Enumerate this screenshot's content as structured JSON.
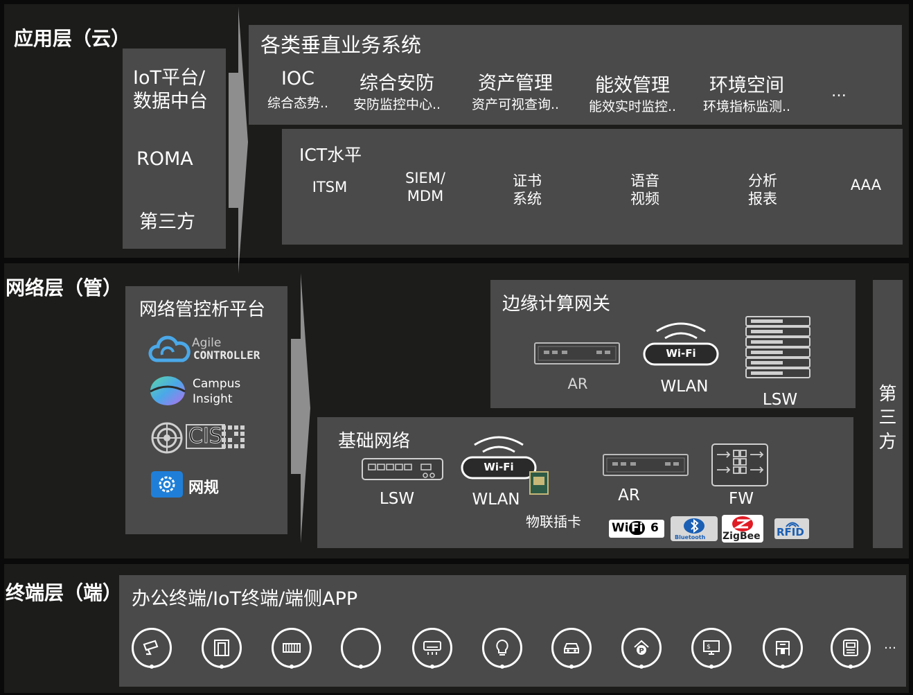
{
  "layers": {
    "app": {
      "title": "应用层（云）",
      "platform": {
        "line1": "IoT平台/",
        "line2": "数据中台",
        "roma": "ROMA",
        "third": "第三方"
      },
      "vertical": {
        "title": "各类垂直业务系统",
        "items": [
          {
            "name": "IOC",
            "sub": "综合态势.."
          },
          {
            "name": "综合安防",
            "sub": "安防监控中心.."
          },
          {
            "name": "资产管理",
            "sub": "资产可视查询.."
          },
          {
            "name": "能效管理",
            "sub": "能效实时监控.."
          },
          {
            "name": "环境空间",
            "sub": "环境指标监测.."
          }
        ],
        "more": "…"
      },
      "ict": {
        "title": "ICT水平",
        "items": [
          {
            "l1": "ITSM",
            "l2": ""
          },
          {
            "l1": "SIEM/",
            "l2": "MDM"
          },
          {
            "l1": "证书",
            "l2": "系统"
          },
          {
            "l1": "语音",
            "l2": "视频"
          },
          {
            "l1": "分析",
            "l2": "报表"
          },
          {
            "l1": "AAA",
            "l2": ""
          }
        ]
      }
    },
    "net": {
      "title": "网络层（管）",
      "mgmt": {
        "title": "网络管控析平台",
        "agile_top": "Agile",
        "agile_bottom": "CONTROLLER",
        "campus_l1": "Campus",
        "campus_l2": "Insight",
        "cis": "CIS",
        "wanggui": "网规"
      },
      "edge": {
        "title": "边缘计算网关",
        "ar": "AR",
        "wlan": "WLAN",
        "lsw": "LSW",
        "wifi_label": "Wi-Fi"
      },
      "base": {
        "title": "基础网络",
        "lsw": "LSW",
        "wlan": "WLAN",
        "iot_card": "物联插卡",
        "ar": "AR",
        "fw": "FW",
        "wifi_label": "Wi-Fi",
        "wifi6_a": "Wi",
        "wifi6_b": "Fi",
        "wifi6_c": "6",
        "bluetooth": "Bluetooth",
        "zigbee": "ZigBee",
        "rfid": "RFID"
      },
      "third": {
        "c1": "第",
        "c2": "三",
        "c3": "方"
      }
    },
    "term": {
      "title": "终端层（端）",
      "box_title": "办公终端/IoT终端/端侧APP",
      "icons": [
        "camera-icon",
        "door-icon",
        "fence-icon",
        "ring-icon",
        "air-conditioner-icon",
        "light-bulb-icon",
        "car-icon",
        "parking-icon",
        "payment-terminal-icon",
        "access-gate-icon",
        "meter-icon"
      ],
      "more": "…"
    }
  },
  "colors": {
    "band": "#1c1c1b",
    "box": "#4a4a4a",
    "arrow": "#8e8e8e",
    "text": "#ffffff"
  }
}
